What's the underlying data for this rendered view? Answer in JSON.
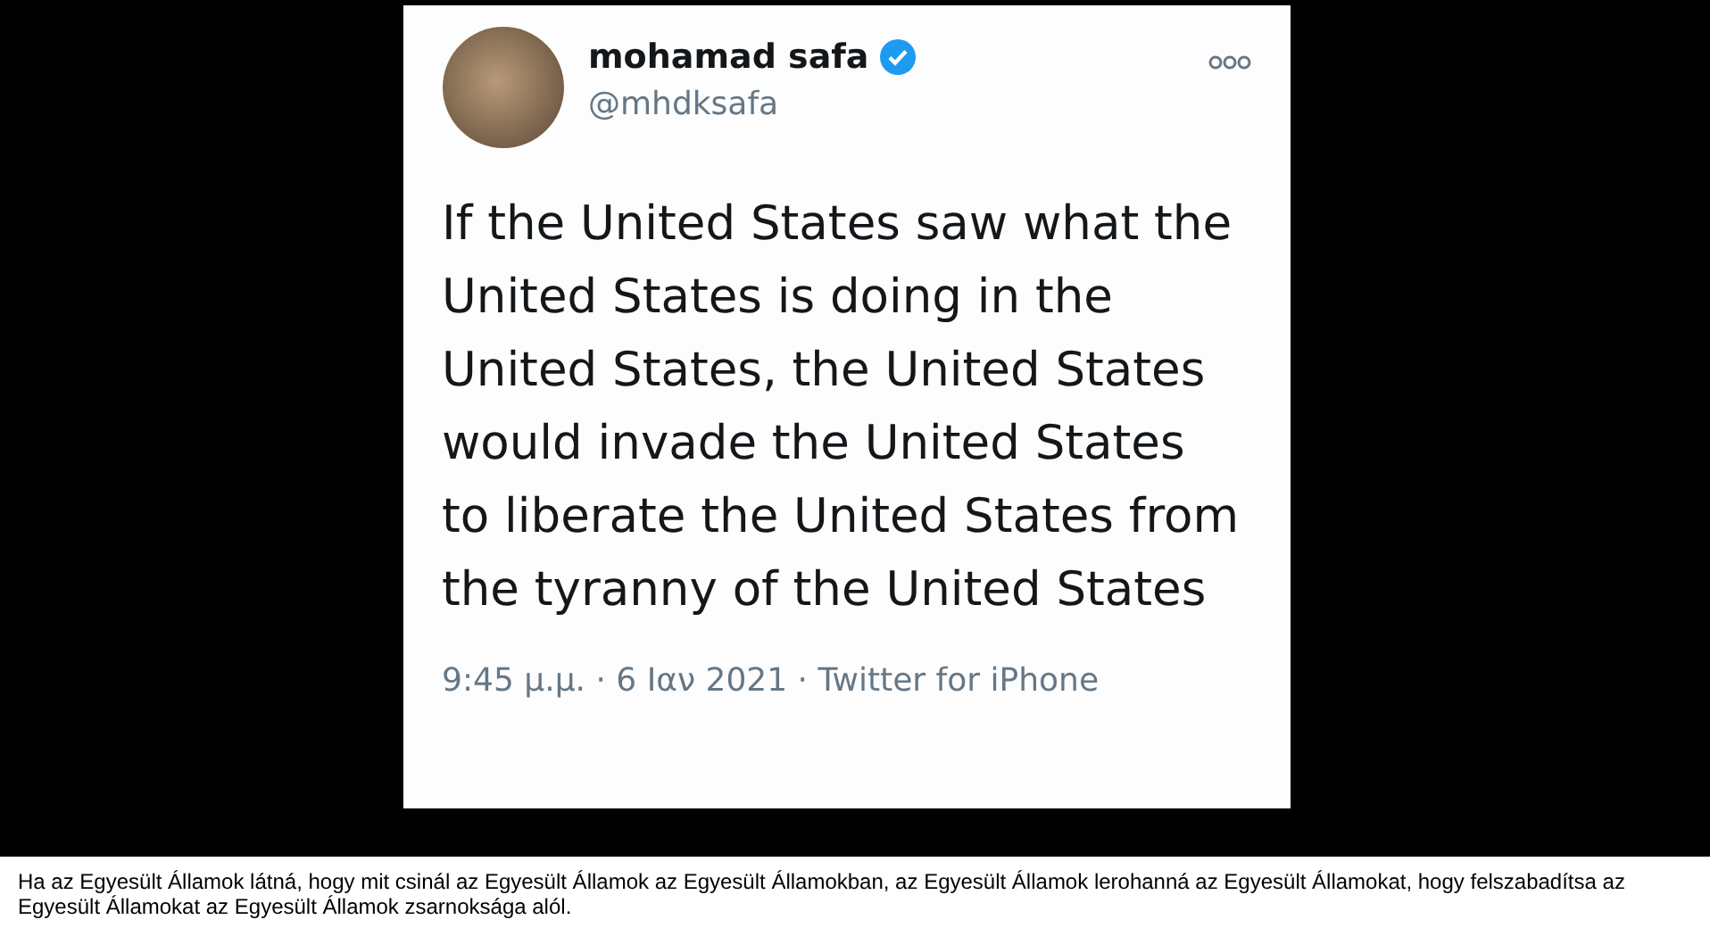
{
  "tweet": {
    "author_name": "mohamad safa",
    "verified": true,
    "handle": "@mhdksafa",
    "text": "If the United States saw what the United States is doing in the United States, the United States would invade the United States to liberate the United States from the tyranny of the United States",
    "meta": "9:45 μ.μ. · 6 Ιαν 2021 · Twitter for iPhone"
  },
  "caption": "Ha az Egyesült Államok látná, hogy mit csinál az Egyesült Államok az Egyesült Államokban, az Egyesült Államok lerohanná az Egyesült Államokat, hogy felszabadítsa az Egyesült Államokat az Egyesült Államok zsarnoksága alól."
}
